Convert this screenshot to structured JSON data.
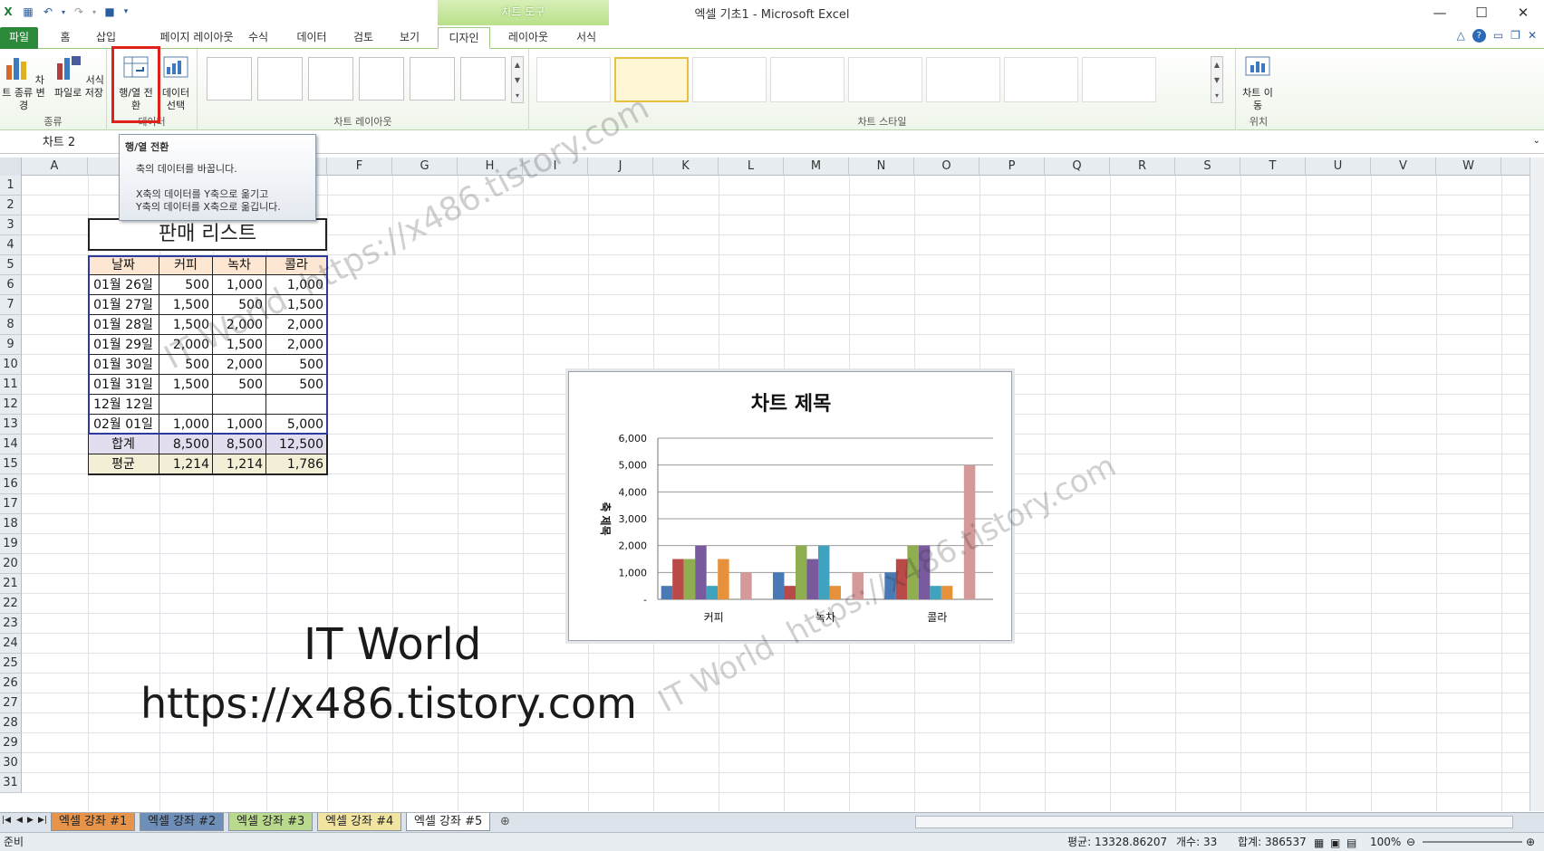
{
  "window": {
    "title": "엑셀 기초1  -  Microsoft Excel",
    "context_band": "차트 도구"
  },
  "tabs": [
    {
      "label": "파일"
    },
    {
      "label": "홈"
    },
    {
      "label": "삽입"
    },
    {
      "label": "페이지 레이아웃"
    },
    {
      "label": "수식"
    },
    {
      "label": "데이터"
    },
    {
      "label": "검토"
    },
    {
      "label": "보기"
    },
    {
      "label": "디자인"
    },
    {
      "label": "레이아웃"
    },
    {
      "label": "서식"
    }
  ],
  "ribbon": {
    "group_type": {
      "name": "종류",
      "btn_change_type": "차트 종류 변경",
      "btn_save_template": "서식 파일로 저장"
    },
    "group_data": {
      "name": "데이터",
      "btn_switch": "행/열 전환",
      "btn_select": "데이터 선택"
    },
    "group_layout": {
      "name": "차트 레이아웃"
    },
    "group_style": {
      "name": "차트 스타일"
    },
    "group_location": {
      "name": "위치",
      "btn_move": "차트 이동"
    }
  },
  "namebox": {
    "value": "차트 2"
  },
  "tooltip": {
    "title": "행/열 전환",
    "line1": "축의 데이터를 바꿉니다.",
    "line2": "X축의 데이터를 Y축으로 옮기고",
    "line3": "Y축의 데이터를 X축으로 옮깁니다."
  },
  "columns": [
    "A",
    "B",
    "C",
    "D",
    "E",
    "F",
    "G",
    "H",
    "I",
    "J",
    "K",
    "L",
    "M",
    "N",
    "O",
    "P",
    "Q",
    "R",
    "S",
    "T",
    "U",
    "V",
    "W"
  ],
  "rows": [
    "1",
    "2",
    "3",
    "4",
    "5",
    "6",
    "7",
    "8",
    "9",
    "10",
    "11",
    "12",
    "13",
    "14",
    "15",
    "16",
    "17",
    "18",
    "19",
    "20",
    "21",
    "22",
    "23",
    "24",
    "25",
    "26",
    "27",
    "28",
    "29",
    "30",
    "31"
  ],
  "sheet": {
    "title": "판매 리스트",
    "headers": [
      "날짜",
      "커피",
      "녹차",
      "콜라"
    ],
    "rows": [
      [
        "01월 26일",
        "500",
        "1,000",
        "1,000"
      ],
      [
        "01월 27일",
        "1,500",
        "500",
        "1,500"
      ],
      [
        "01월 28일",
        "1,500",
        "2,000",
        "2,000"
      ],
      [
        "01월 29일",
        "2,000",
        "1,500",
        "2,000"
      ],
      [
        "01월 30일",
        "500",
        "2,000",
        "500"
      ],
      [
        "01월 31일",
        "1,500",
        "500",
        "500"
      ],
      [
        "12월 12일",
        "",
        "",
        ""
      ],
      [
        "02월 01일",
        "1,000",
        "1,000",
        "5,000"
      ]
    ],
    "total": [
      "합계",
      "8,500",
      "8,500",
      "12,500"
    ],
    "average": [
      "평균",
      "1,214",
      "1,214",
      "1,786"
    ]
  },
  "chart_data": {
    "type": "bar",
    "title": "차트 제목",
    "ylabel": "축 제목",
    "xlabel": "",
    "categories": [
      "커피",
      "녹차",
      "콜라"
    ],
    "ylim": [
      0,
      6000
    ],
    "yticks": [
      "-",
      "1,000",
      "2,000",
      "3,000",
      "4,000",
      "5,000",
      "6,000"
    ],
    "series": [
      {
        "values": [
          500,
          1000,
          1000
        ],
        "color": "#4a7ab5"
      },
      {
        "values": [
          1500,
          500,
          1500
        ],
        "color": "#b94a48"
      },
      {
        "values": [
          1500,
          2000,
          2000
        ],
        "color": "#8fae50"
      },
      {
        "values": [
          2000,
          1500,
          2000
        ],
        "color": "#7a5a9e"
      },
      {
        "values": [
          500,
          2000,
          500
        ],
        "color": "#3fa3c0"
      },
      {
        "values": [
          1500,
          500,
          500
        ],
        "color": "#e8913b"
      },
      {
        "values": [
          0,
          0,
          0
        ],
        "color": "#8ea4c8"
      },
      {
        "values": [
          1000,
          1000,
          5000
        ],
        "color": "#d49a9a"
      }
    ],
    "grid": true
  },
  "watermark": {
    "line1": "IT World",
    "line2": "https://x486.tistory.com"
  },
  "sheettabs": [
    "엑셀 강좌 #1",
    "엑셀 강좌 #2",
    "엑셀 강좌 #3",
    "엑셀 강좌 #4",
    "엑셀 강좌 #5"
  ],
  "status": {
    "ready": "준비",
    "average": "평균: 13328.86207",
    "count": "개수: 33",
    "sum": "합계: 386537",
    "zoom": "100%"
  }
}
